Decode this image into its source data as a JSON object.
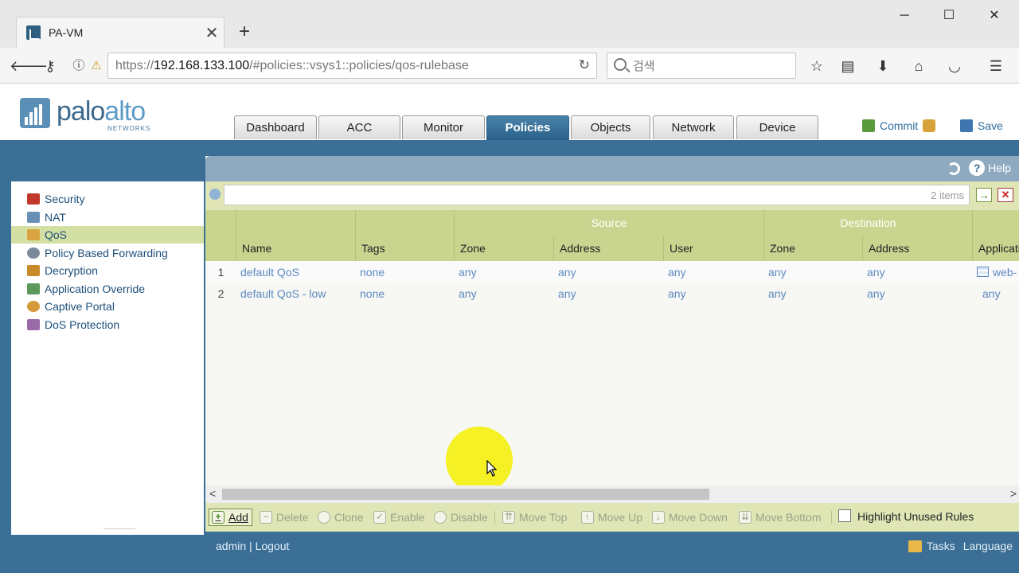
{
  "browser": {
    "tab_title": "PA-VM",
    "url_prefix": "https://",
    "url_host": "192.168.133.100",
    "url_path": "/#policies::vsys1::policies/qos-rulebase",
    "search_placeholder": "검색",
    "window_buttons": [
      "─",
      "☐",
      "✕"
    ]
  },
  "app": {
    "logo_word": "palo",
    "logo_word2": "alto",
    "logo_sub": "NETWORKS",
    "tabs": [
      "Dashboard",
      "ACC",
      "Monitor",
      "Policies",
      "Objects",
      "Network",
      "Device"
    ],
    "active_tab": "Policies",
    "commit_label": "Commit",
    "save_label": "Save",
    "help_label": "Help"
  },
  "sidebar": {
    "items": [
      {
        "label": "Security",
        "color": "#c0392b"
      },
      {
        "label": "NAT",
        "color": "#6a8fb5"
      },
      {
        "label": "QoS",
        "color": "#d9a441"
      },
      {
        "label": "Policy Based Forwarding",
        "color": "#7a8a9a"
      },
      {
        "label": "Decryption",
        "color": "#c98a2a"
      },
      {
        "label": "Application Override",
        "color": "#5b9a5b"
      },
      {
        "label": "Captive Portal",
        "color": "#d49a3a"
      },
      {
        "label": "DoS Protection",
        "color": "#9a6aa8"
      }
    ],
    "active_index": 2
  },
  "filter": {
    "value": "",
    "count_text": "2 items",
    "apply_glyph": "→",
    "clear_glyph": "✕"
  },
  "grid": {
    "groups": [
      "Source",
      "Destination"
    ],
    "columns": [
      "Name",
      "Tags",
      "Zone",
      "Address",
      "User",
      "Zone",
      "Address",
      "Applicati"
    ],
    "rows": [
      {
        "num": "1",
        "name": "default QoS",
        "tags": "none",
        "src_zone": "any",
        "src_addr": "any",
        "src_user": "any",
        "dst_zone": "any",
        "dst_addr": "any",
        "app": "web-"
      },
      {
        "num": "2",
        "name": "default QoS - low",
        "tags": "none",
        "src_zone": "any",
        "src_addr": "any",
        "src_user": "any",
        "dst_zone": "any",
        "dst_addr": "any",
        "app": "any"
      }
    ]
  },
  "toolbar": {
    "add": "Add",
    "delete": "Delete",
    "clone": "Clone",
    "enable": "Enable",
    "disable": "Disable",
    "move_top": "Move Top",
    "move_up": "Move Up",
    "move_down": "Move Down",
    "move_bottom": "Move Bottom",
    "highlight_unused": "Highlight Unused Rules",
    "highlight_checked": false
  },
  "status": {
    "user": "admin",
    "separator": " | ",
    "logout": "Logout",
    "tasks": "Tasks",
    "language": "Language"
  },
  "scroll": {
    "left_glyph": "<",
    "right_glyph": ">"
  }
}
